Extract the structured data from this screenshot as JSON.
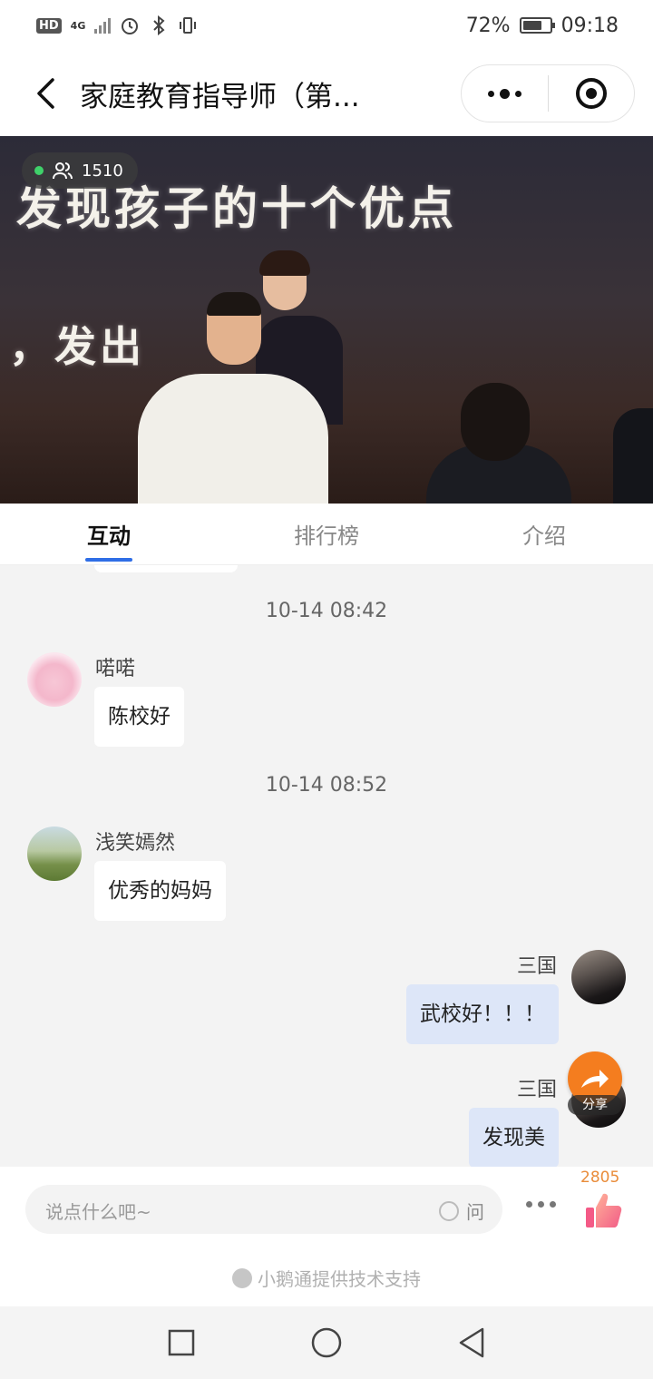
{
  "status_bar": {
    "network_badge": "HD",
    "network_type": "4G",
    "battery": "72%",
    "time": "09:18",
    "battery_level": 0.72
  },
  "nav": {
    "title": "家庭教育指导师（第..."
  },
  "video": {
    "viewer_count": "1510",
    "slide_line1": "发现孩子的十个优点",
    "slide_line2": "，发出"
  },
  "tabs": [
    {
      "label": "互动",
      "active": true
    },
    {
      "label": "排行榜",
      "active": false
    },
    {
      "label": "介绍",
      "active": false
    }
  ],
  "chat": {
    "messages": [
      {
        "timestamp": "10-14 08:42",
        "user": "喏喏",
        "text": "陈校好",
        "side": "left"
      },
      {
        "timestamp": "10-14 08:52",
        "user": "浅笑嫣然",
        "text": "优秀的妈妈",
        "side": "left"
      },
      {
        "user": "三国",
        "text": "武校好！！！",
        "side": "right"
      },
      {
        "user": "三国",
        "text": "发现美",
        "side": "right"
      }
    ],
    "share_label": "分享"
  },
  "input": {
    "placeholder": "说点什么吧~",
    "ask_label": "问",
    "like_count": "2805"
  },
  "footer": {
    "powered_by": "小鹅通提供技术支持"
  },
  "colors": {
    "accent": "#2f6ee6",
    "share": "#f47d1f",
    "like": "#e98c3a",
    "self_bubble": "#dde6f8"
  }
}
